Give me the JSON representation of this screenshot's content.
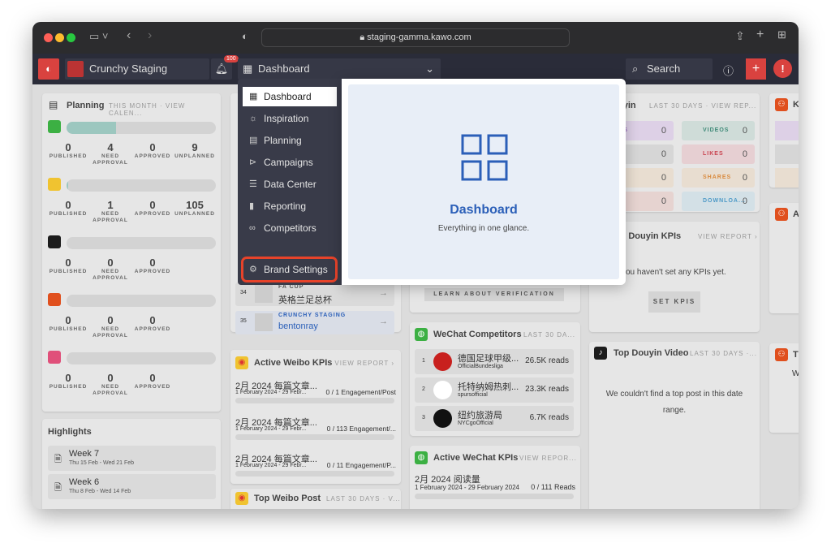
{
  "browser": {
    "url": "staging-gamma.kawo.com"
  },
  "header": {
    "brand": "Crunchy Staging",
    "notif_count": "100",
    "section": "Dashboard",
    "search": "Search"
  },
  "planning": {
    "title": "Planning",
    "sub": "THIS MONTH · VIEW CALEN...",
    "labels": [
      "PUBLISHED",
      "NEED APPROVAL",
      "APPROVED",
      "UNPLANNED"
    ],
    "channels": [
      {
        "icon": "wechat-icon",
        "color": "#3cb043",
        "progress": 0.33,
        "values": [
          "0",
          "4",
          "0",
          "9"
        ]
      },
      {
        "icon": "weibo-icon",
        "color": "#f0c330",
        "progress": 0.01,
        "values": [
          "0",
          "1",
          "0",
          "105"
        ]
      },
      {
        "icon": "douyin-icon",
        "color": "#1c1c1c",
        "progress": 0,
        "values": [
          "0",
          "0",
          "0"
        ]
      },
      {
        "icon": "kuaishou-icon",
        "color": "#e0501e",
        "progress": 0,
        "values": [
          "0",
          "0",
          "0"
        ]
      },
      {
        "icon": "lila-icon",
        "color": "#e0507a",
        "progress": 0,
        "values": [
          "0",
          "0",
          "0"
        ]
      }
    ]
  },
  "highlights": {
    "title": "Highlights",
    "items": [
      {
        "title": "Week 7",
        "range": "Thu 15 Feb - Wed 21 Feb"
      },
      {
        "title": "Week 6",
        "range": "Thu 8 Feb - Wed 14 Feb"
      }
    ]
  },
  "competitors_list": [
    {
      "rank": "34",
      "label": "FA CUP",
      "name": "英格兰足总杯"
    },
    {
      "rank": "35",
      "label": "CRUNCHY STAGING",
      "name": "bentonray"
    }
  ],
  "weibo_kpis": {
    "title": "Active Weibo KPIs",
    "link": "VIEW REPORT ›",
    "items": [
      {
        "name": "2月 2024 每篇文章...",
        "range": "1 February 2024 - 29 Febr...",
        "value": "0 / 1 Engagement/Post"
      },
      {
        "name": "2月 2024 每篇文章...",
        "range": "1 February 2024 - 29 Febr...",
        "value": "0 / 113 Engagement/..."
      },
      {
        "name": "2月 2024 每篇文章...",
        "range": "1 February 2024 - 29 Febr...",
        "value": "0 / 11 Engagement/P..."
      }
    ]
  },
  "top_weibo": {
    "title": "Top Weibo Post",
    "sub": "LAST 30 DAYS · V..."
  },
  "verification": {
    "button": "LEARN ABOUT VERIFICATION"
  },
  "wechat_competitors": {
    "title": "WeChat Competitors",
    "sub": "LAST 30 DA...",
    "items": [
      {
        "rank": "1",
        "name": "德国足球甲级...",
        "handle": "OfficialBundesliga",
        "reads": "26.5K reads"
      },
      {
        "rank": "2",
        "name": "托特纳姆热刺...",
        "handle": "spursofficial",
        "reads": "23.3K reads"
      },
      {
        "rank": "3",
        "name": "纽约旅游局",
        "handle": "NYCgoOfficial",
        "reads": "6.7K reads"
      }
    ]
  },
  "wechat_kpis": {
    "title": "Active WeChat KPIs",
    "link": "VIEW REPOR...",
    "items": [
      {
        "name": "2月 2024 阅读量",
        "range": "1 February 2024 - 29 February 2024",
        "value": "0 / 111 Reads"
      }
    ]
  },
  "douyin": {
    "title": "uyin",
    "sub": "LAST 30 DAYS · VIEW REP...",
    "metrics": [
      {
        "label": "LLOWERS",
        "value": "0",
        "bg": "#ddd0e6",
        "fg": "#9b6fc0"
      },
      {
        "label": "VIDEOS",
        "value": "0",
        "bg": "#cfdcd8",
        "fg": "#3f8a78"
      },
      {
        "label": "YS",
        "value": "0",
        "bg": "#d6d6d6",
        "fg": "#666"
      },
      {
        "label": "LIKES",
        "value": "0",
        "bg": "#e6cfd2",
        "fg": "#c9434f"
      },
      {
        "label": "MMENTS",
        "value": "0",
        "bg": "#e8ddd0",
        "fg": "#e3a35a"
      },
      {
        "label": "SHARES",
        "value": "0",
        "bg": "#e8ddd0",
        "fg": "#d98a3e"
      },
      {
        "label": "RWARDS",
        "value": "0",
        "bg": "#e6d3d0",
        "fg": "#d0604e"
      },
      {
        "label": "DOWNLOA...",
        "value": "0",
        "bg": "#d3e0e6",
        "fg": "#4e9ac7"
      }
    ]
  },
  "douyin_kpis": {
    "title": "ive Douyin KPIs",
    "link": "VIEW REPORT ›",
    "empty": "ou haven't set any KPIs yet.",
    "button": "SET KPIS"
  },
  "top_douyin": {
    "title": "Top Douyin Video",
    "sub": "LAST 30 DAYS ·...",
    "empty": "We couldn't find a top post in this date range."
  },
  "right_col": {
    "letters": [
      "K",
      "A",
      "T"
    ],
    "w": "W"
  },
  "menu": {
    "items": [
      {
        "label": "Dashboard",
        "icon": "grid-icon",
        "glyph": "▦"
      },
      {
        "label": "Inspiration",
        "icon": "lightbulb-icon",
        "glyph": "☼"
      },
      {
        "label": "Planning",
        "icon": "calendar-icon",
        "glyph": "▤"
      },
      {
        "label": "Campaigns",
        "icon": "campaign-icon",
        "glyph": "⊳"
      },
      {
        "label": "Data Center",
        "icon": "database-icon",
        "glyph": "☰"
      },
      {
        "label": "Reporting",
        "icon": "chart-icon",
        "glyph": "▮"
      },
      {
        "label": "Competitors",
        "icon": "binoculars-icon",
        "glyph": "∞"
      }
    ],
    "settings": "Brand Settings"
  },
  "preview": {
    "title": "Dashboard",
    "desc": "Everything in one glance."
  },
  "colors": {
    "accent": "#2b5fb8",
    "brand_red": "#d9423f",
    "highlight_ring": "#e8432a"
  }
}
